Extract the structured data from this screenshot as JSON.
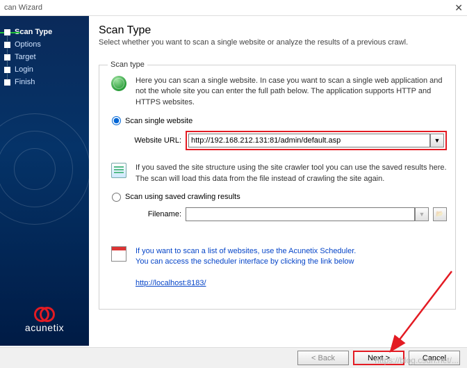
{
  "window": {
    "title": "can Wizard"
  },
  "sidebar": {
    "steps": [
      {
        "label": "Scan Type",
        "active": true
      },
      {
        "label": "Options"
      },
      {
        "label": "Target"
      },
      {
        "label": "Login"
      },
      {
        "label": "Finish"
      }
    ],
    "brand": "acunetix"
  },
  "header": {
    "title": "Scan Type",
    "subtitle": "Select whether you want to scan a single website or analyze the results of a previous crawl."
  },
  "fieldset": {
    "legend": "Scan type",
    "intro": "Here you can scan a single website. In case you want to scan a single web application and not the whole site you can enter the full path below. The application supports HTTP and HTTPS websites.",
    "opt1": {
      "radio_label": "Scan single website",
      "url_label": "Website URL:",
      "url_value": "http://192.168.212.131:81/admin/default.asp"
    },
    "saved_info": "If you saved the site structure using the site crawler tool you can use the saved results here. The scan will load this data from the file instead of crawling the site again.",
    "opt2": {
      "radio_label": "Scan using saved crawling results",
      "filename_label": "Filename:",
      "filename_value": ""
    },
    "scheduler": {
      "text1": "If you want to scan a list of websites, use the Acunetix Scheduler.",
      "text2": "You can access the scheduler interface by clicking the link below",
      "link": "http://localhost:8183/"
    }
  },
  "buttons": {
    "back": "< Back",
    "next": "Next >",
    "cancel": "Cancel"
  }
}
